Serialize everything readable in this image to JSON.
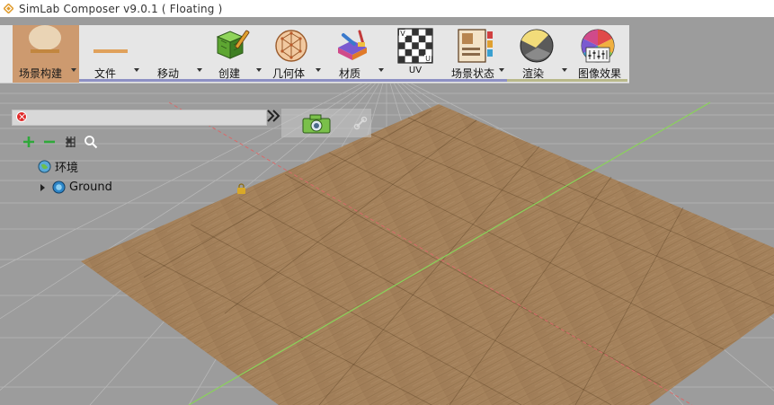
{
  "window": {
    "title": "SimLab Composer v9.0.1 ( Floating )"
  },
  "toolbar": {
    "items": [
      {
        "id": "scene",
        "label": "场景构建",
        "active": true
      },
      {
        "id": "file",
        "label": "文件"
      },
      {
        "id": "move",
        "label": "移动"
      },
      {
        "id": "create",
        "label": "创建"
      },
      {
        "id": "geometry",
        "label": "几何体"
      },
      {
        "id": "material",
        "label": "材质"
      },
      {
        "id": "uv",
        "label": "UV"
      },
      {
        "id": "scene-state",
        "label": "场景状态"
      },
      {
        "id": "render",
        "label": "渲染"
      },
      {
        "id": "image-effects",
        "label": "图像效果"
      }
    ]
  },
  "scene_tree": {
    "search_placeholder": "",
    "items": [
      {
        "label": "环境",
        "icon": "environment-globe-icon"
      },
      {
        "label": "Ground",
        "icon": "ground-object-icon",
        "expandable": true
      }
    ]
  },
  "colors": {
    "active_tab": "#cd9a6f",
    "toolbar_bg": "#e6e6e6",
    "floor_wood": "#a6835e",
    "grid_bg": "#9a9a9a",
    "axis_x": "#d86a6a",
    "axis_y": "#8ad35a"
  }
}
